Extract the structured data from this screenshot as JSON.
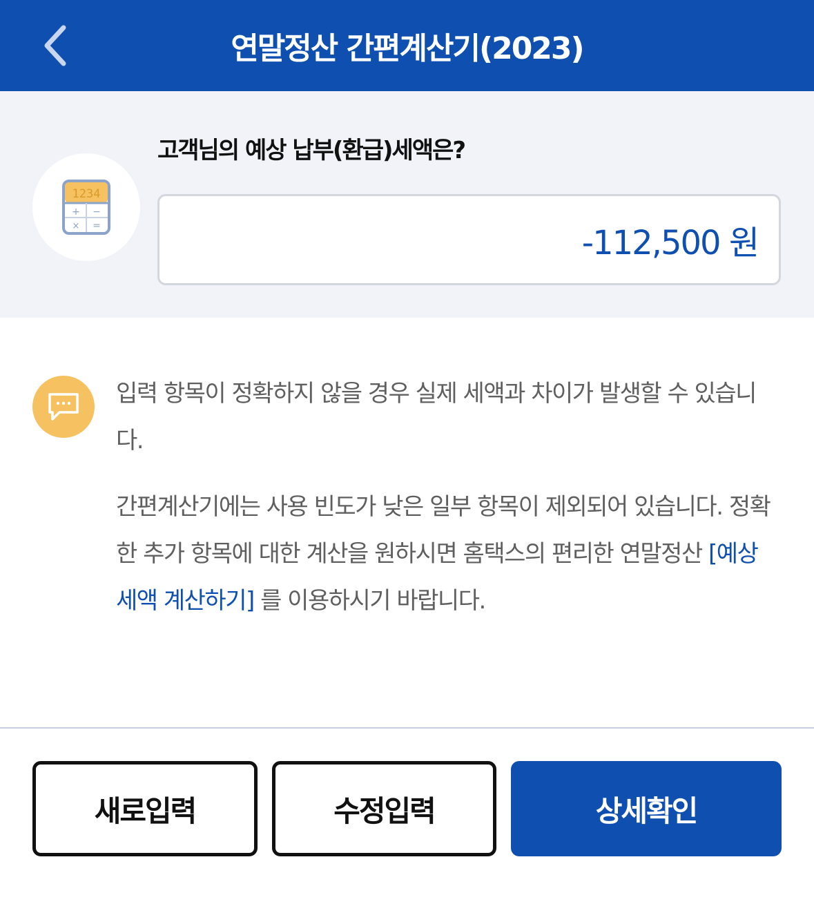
{
  "header": {
    "title": "연말정산 간편계산기(2023)"
  },
  "result": {
    "question": "고객님의 예상 납부(환급)세액은?",
    "amount": "-112,500 원",
    "calculator_display": "1234"
  },
  "notice": {
    "paragraph1": "입력 항목이 정확하지 않을 경우 실제 세액과 차이가 발생할 수 있습니다.",
    "paragraph2_before": "간편계산기에는 사용 빈도가 낮은 일부 항목이 제외되어 있습니다. 정확한 추가 항목에 대한 계산을 원하시면 홈택스의 편리한 연말정산 ",
    "paragraph2_link": "[예상 세액 계산하기]",
    "paragraph2_after": " 를 이용하시기 바랍니다."
  },
  "buttons": {
    "new_input": "새로입력",
    "edit_input": "수정입력",
    "details": "상세확인"
  },
  "colors": {
    "brand": "#0e4fb0",
    "notice_icon": "#f6c160",
    "panel_bg": "#f1f3f9"
  },
  "icons": {
    "back": "chevron-left-icon",
    "calculator": "calculator-icon",
    "notice": "chat-bubble-icon"
  }
}
